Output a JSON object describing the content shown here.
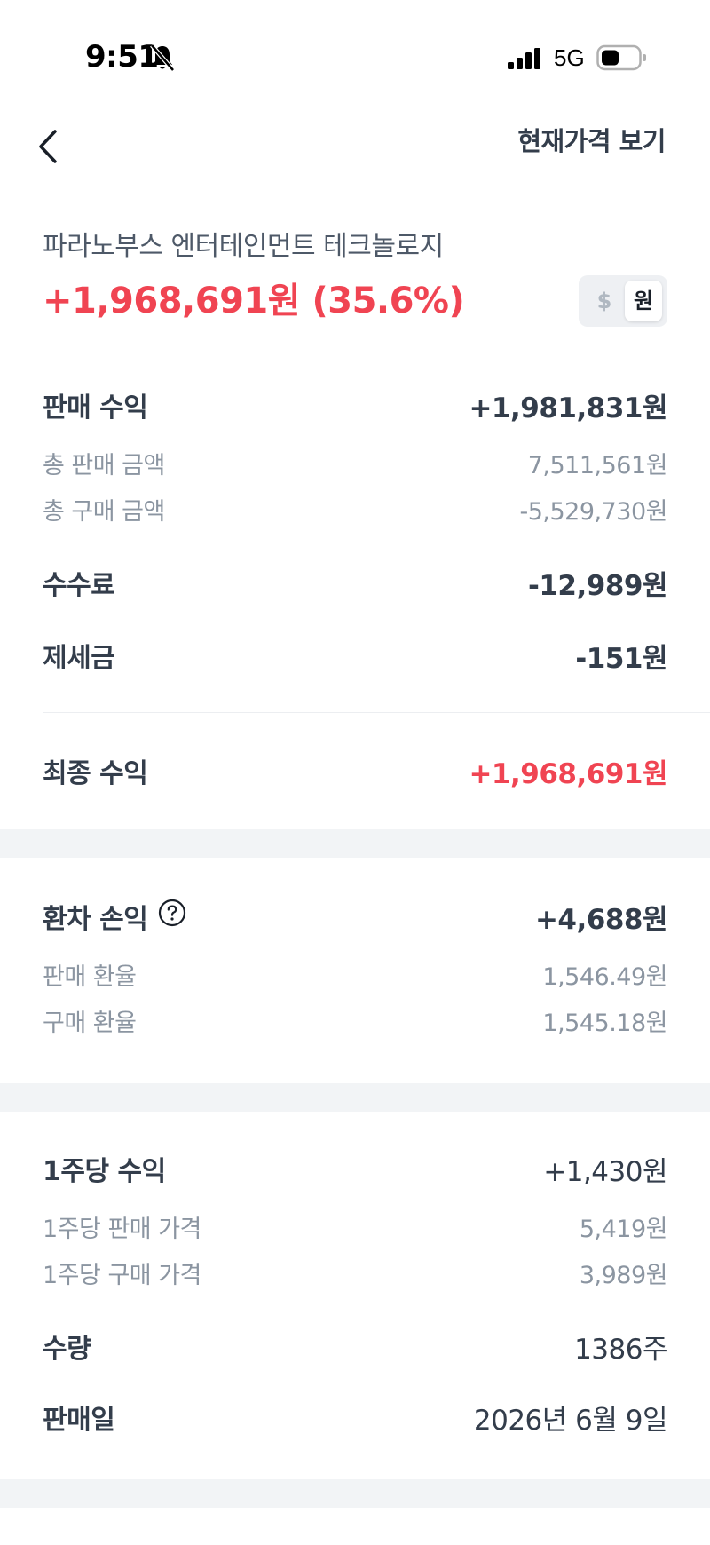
{
  "status_bar": {
    "time": "9:51",
    "network": "5G"
  },
  "nav": {
    "view_price_label": "현재가격 보기"
  },
  "stock": {
    "name": "파라노부스 엔터테인먼트 테크놀로지",
    "headline": "+1,968,691원 (35.6%)"
  },
  "currency_toggle": {
    "usd": "$",
    "krw": "원",
    "selected": "krw"
  },
  "sales": {
    "profit_label": "판매 수익",
    "profit_value": "+1,981,831원",
    "total_sale_label": "총 판매 금액",
    "total_sale_value": "7,511,561원",
    "total_buy_label": "총 구매 금액",
    "total_buy_value": "-5,529,730원",
    "fee_label": "수수료",
    "fee_value": "-12,989원",
    "tax_label": "제세금",
    "tax_value": "-151원",
    "final_label": "최종 수익",
    "final_value": "+1,968,691원"
  },
  "fx": {
    "label": "환차 손익",
    "value": "+4,688원",
    "sale_rate_label": "판매 환율",
    "sale_rate_value": "1,546.49원",
    "buy_rate_label": "구매 환율",
    "buy_rate_value": "1,545.18원"
  },
  "per_share": {
    "label": "1주당 수익",
    "value": "+1,430원",
    "sale_price_label": "1주당 판매 가격",
    "sale_price_value": "5,419원",
    "buy_price_label": "1주당 구매 가격",
    "buy_price_value": "3,989원",
    "qty_label": "수량",
    "qty_value": "1386주",
    "date_label": "판매일",
    "date_value": "2026년 6월 9일"
  },
  "colors": {
    "profit_red": "#f04452",
    "text_dark": "#333d4b",
    "text_gray": "#8b95a1",
    "band": "#f2f4f6"
  }
}
